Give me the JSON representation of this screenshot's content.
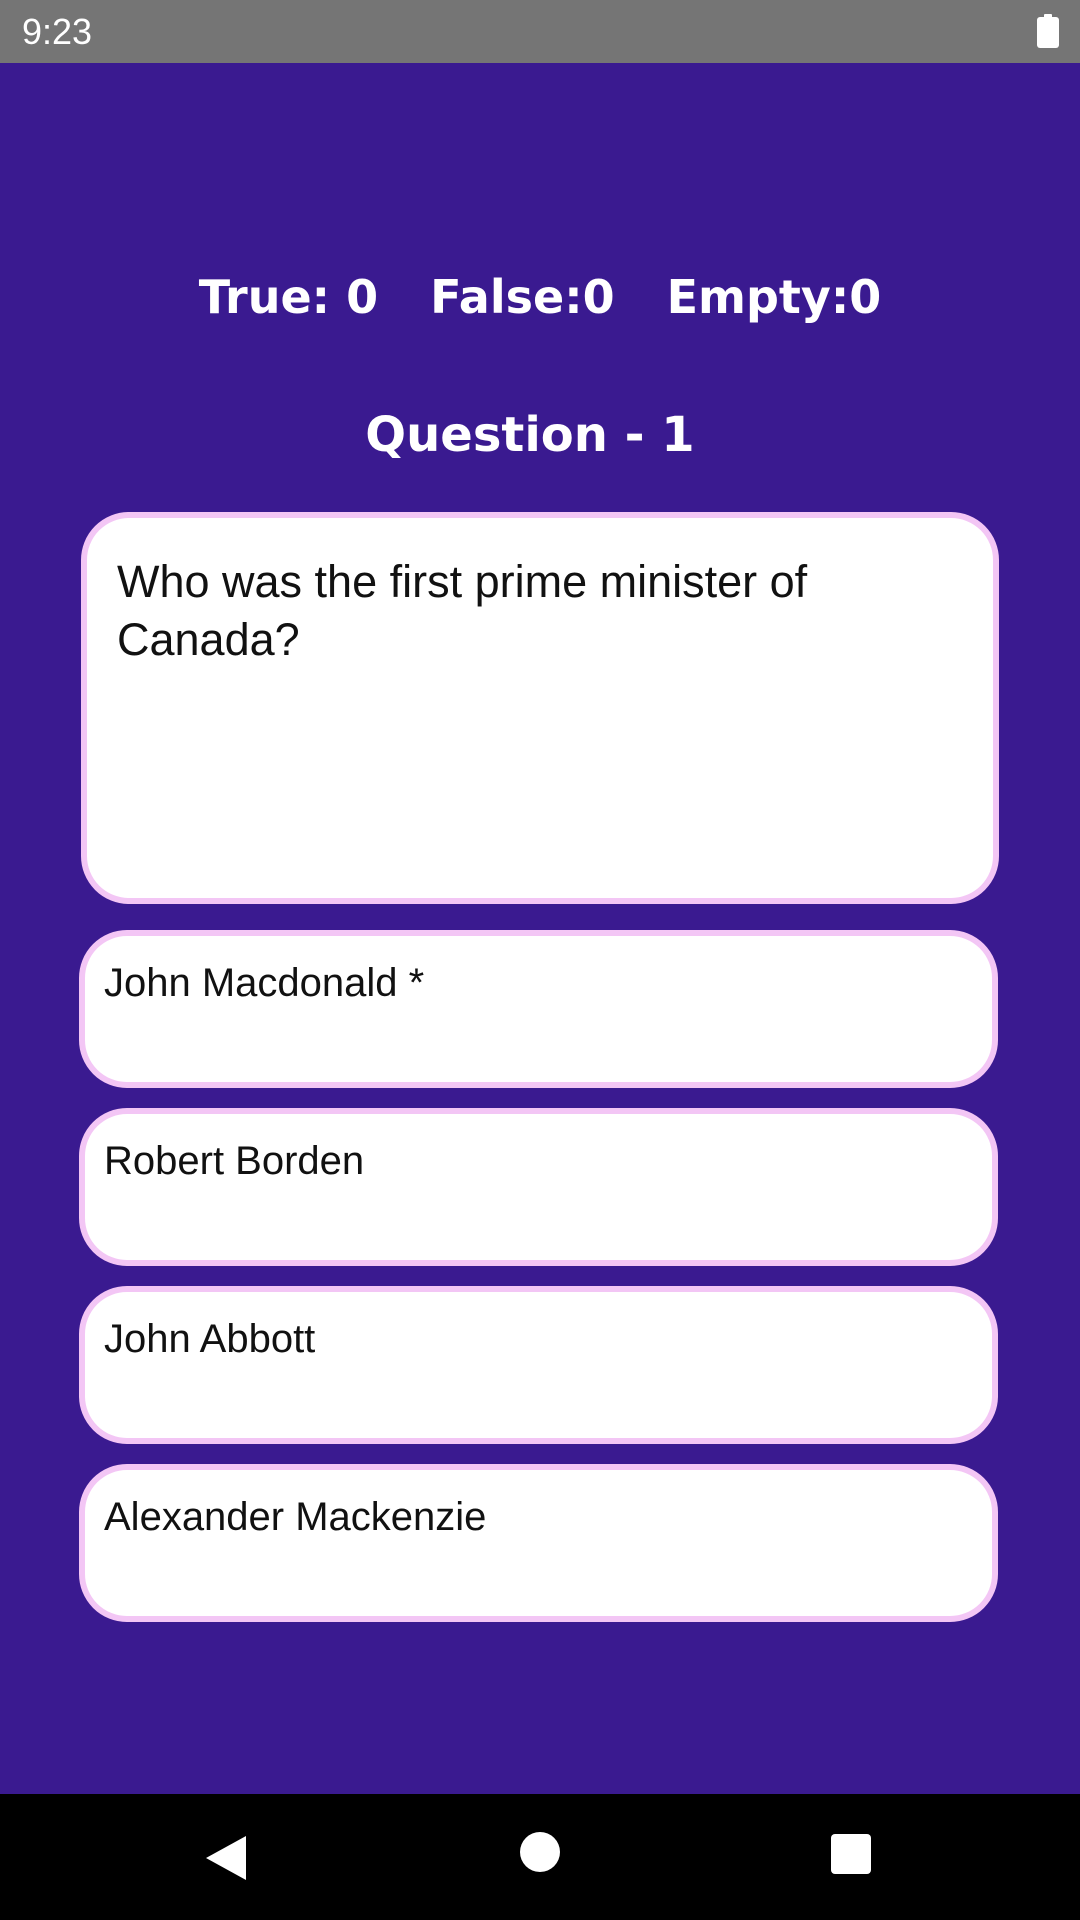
{
  "status_bar": {
    "time": "9:23"
  },
  "score": {
    "true_label": "True: 0",
    "false_label": "False:0",
    "empty_label": "Empty:0"
  },
  "question": {
    "title": "Question - 1",
    "text": "Who was the first prime minister of Canada?"
  },
  "options": [
    {
      "label": "John Macdonald *"
    },
    {
      "label": "Robert Borden"
    },
    {
      "label": "John Abbott"
    },
    {
      "label": "Alexander Mackenzie"
    }
  ],
  "colors": {
    "background": "#3a1a90",
    "card_border": "#f3c6f5",
    "status_bar": "#757575",
    "nav_bar": "#000000"
  },
  "icons": {
    "battery": "battery-icon",
    "back": "back-triangle-icon",
    "home": "home-circle-icon",
    "recents": "recents-square-icon"
  }
}
